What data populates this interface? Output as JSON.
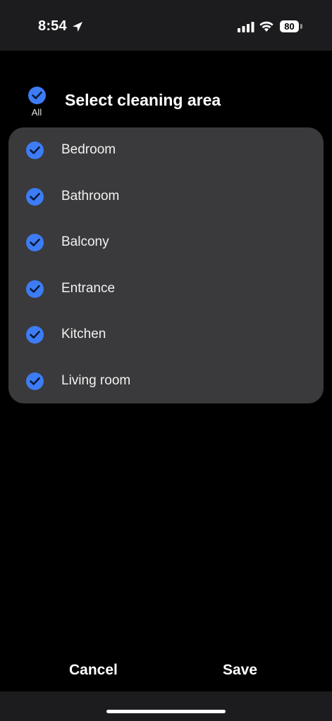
{
  "status_bar": {
    "time": "8:54",
    "battery": "80",
    "icons": [
      "location-arrow-icon",
      "cellular-signal-icon",
      "wifi-icon",
      "battery-icon"
    ]
  },
  "header": {
    "all_label": "All",
    "title": "Select cleaning area",
    "all_checked": true
  },
  "rooms": [
    {
      "label": "Bedroom",
      "checked": true
    },
    {
      "label": "Bathroom",
      "checked": true
    },
    {
      "label": "Balcony",
      "checked": true
    },
    {
      "label": "Entrance",
      "checked": true
    },
    {
      "label": "Kitchen",
      "checked": true
    },
    {
      "label": "Living room",
      "checked": true
    }
  ],
  "footer": {
    "cancel_label": "Cancel",
    "save_label": "Save"
  },
  "colors": {
    "accent": "#3d7cf5",
    "card_background": "#3a3a3c",
    "page_background": "#000000"
  }
}
